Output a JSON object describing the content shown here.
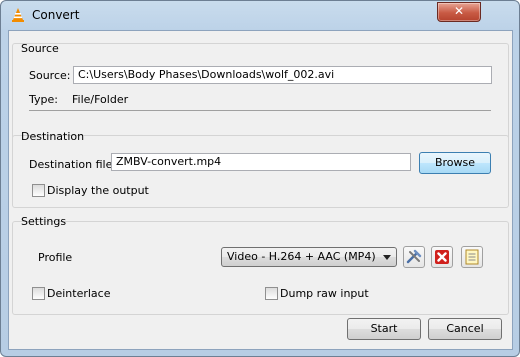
{
  "window": {
    "title": "Convert",
    "close_glyph": "✕"
  },
  "source": {
    "group_label": "Source",
    "source_label": "Source:",
    "source_value": "C:\\Users\\Body Phases\\Downloads\\wolf_002.avi",
    "type_label": "Type:",
    "type_value": "File/Folder"
  },
  "destination": {
    "group_label": "Destination",
    "file_label": "Destination file:",
    "file_value": "ZMBV-convert.mp4",
    "browse_label": "Browse",
    "display_output_label": "Display the output",
    "display_output_checked": false
  },
  "settings": {
    "group_label": "Settings",
    "profile_label": "Profile",
    "profile_selected": "Video - H.264 + AAC (MP4)",
    "deinterlace_label": "Deinterlace",
    "deinterlace_checked": false,
    "dump_raw_label": "Dump raw input",
    "dump_raw_checked": false,
    "icons": [
      "edit-profile-icon",
      "delete-profile-icon",
      "new-profile-icon"
    ]
  },
  "footer": {
    "start_label": "Start",
    "cancel_label": "Cancel"
  },
  "colors": {
    "accent": "#3c7fb1",
    "close_red": "#c85a44",
    "delete_red": "#d0201c",
    "vlc_orange": "#f28c00"
  }
}
